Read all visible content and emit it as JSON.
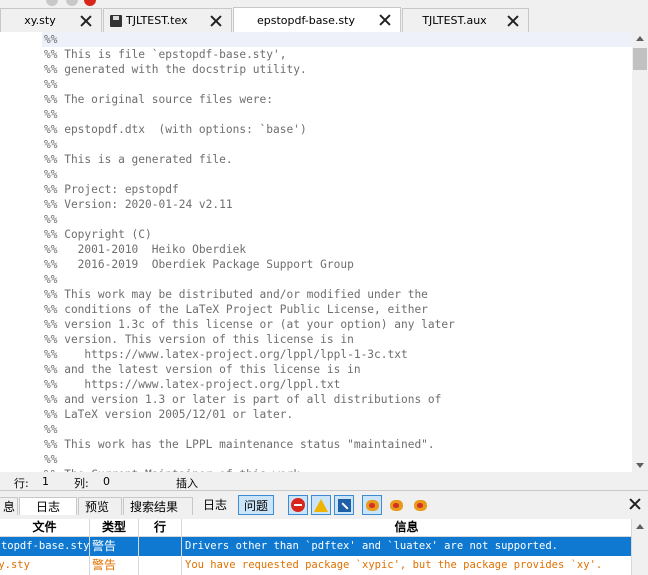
{
  "tabs": [
    {
      "label": "xy.sty",
      "active": false,
      "modified_icon": null
    },
    {
      "label": "TJLTEST.tex",
      "active": false,
      "modified_icon": "floppy-icon"
    },
    {
      "label": "epstopdf-base.sty",
      "active": true,
      "modified_icon": null
    },
    {
      "label": "TJLTEST.aux",
      "active": false,
      "modified_icon": null
    }
  ],
  "editor": {
    "lines": [
      "%%",
      "%% This is file `epstopdf-base.sty',",
      "%% generated with the docstrip utility.",
      "%%",
      "%% The original source files were:",
      "%%",
      "%% epstopdf.dtx  (with options: `base')",
      "%%",
      "%% This is a generated file.",
      "%%",
      "%% Project: epstopdf",
      "%% Version: 2020-01-24 v2.11",
      "%%",
      "%% Copyright (C)",
      "%%   2001-2010  Heiko Oberdiek",
      "%%   2016-2019  Oberdiek Package Support Group",
      "%%",
      "%% This work may be distributed and/or modified under the",
      "%% conditions of the LaTeX Project Public License, either",
      "%% version 1.3c of this license or (at your option) any later",
      "%% version. This version of this license is in",
      "%%    https://www.latex-project.org/lppl/lppl-1-3c.txt",
      "%% and the latest version of this license is in",
      "%%    https://www.latex-project.org/lppl.txt",
      "%% and version 1.3 or later is part of all distributions of",
      "%% LaTeX version 2005/12/01 or later.",
      "%%",
      "%% This work has the LPPL maintenance status \"maintained\".",
      "%%",
      "%% The Current Maintainer of this work"
    ]
  },
  "status": {
    "line_label": "行:",
    "line_value": "1",
    "col_label": "列:",
    "col_value": "0",
    "mode": "插入"
  },
  "panel": {
    "tabs": [
      {
        "label": "息",
        "active": false
      },
      {
        "label": "日志",
        "active": true
      },
      {
        "label": "预览",
        "active": false
      },
      {
        "label": "搜索结果",
        "active": false
      }
    ],
    "filter_log": "日志",
    "filter_issues": "问题",
    "columns": {
      "file": "文件",
      "type": "类型",
      "line": "行",
      "message": "信息"
    },
    "rows": [
      {
        "file": "epstopdf-base.sty",
        "type": "警告",
        "line": "",
        "message": "Drivers other than `pdftex' and `luatex' are not supported.",
        "selected": true
      },
      {
        "file": "xy.sty",
        "type": "警告",
        "line": "",
        "message": "You have requested package `xypic', but the package provides `xy'.",
        "selected": false
      }
    ]
  },
  "colors": {
    "selection": "#0f79d1",
    "warning_text": "#e07000",
    "comment_text": "#6e6e6e"
  }
}
